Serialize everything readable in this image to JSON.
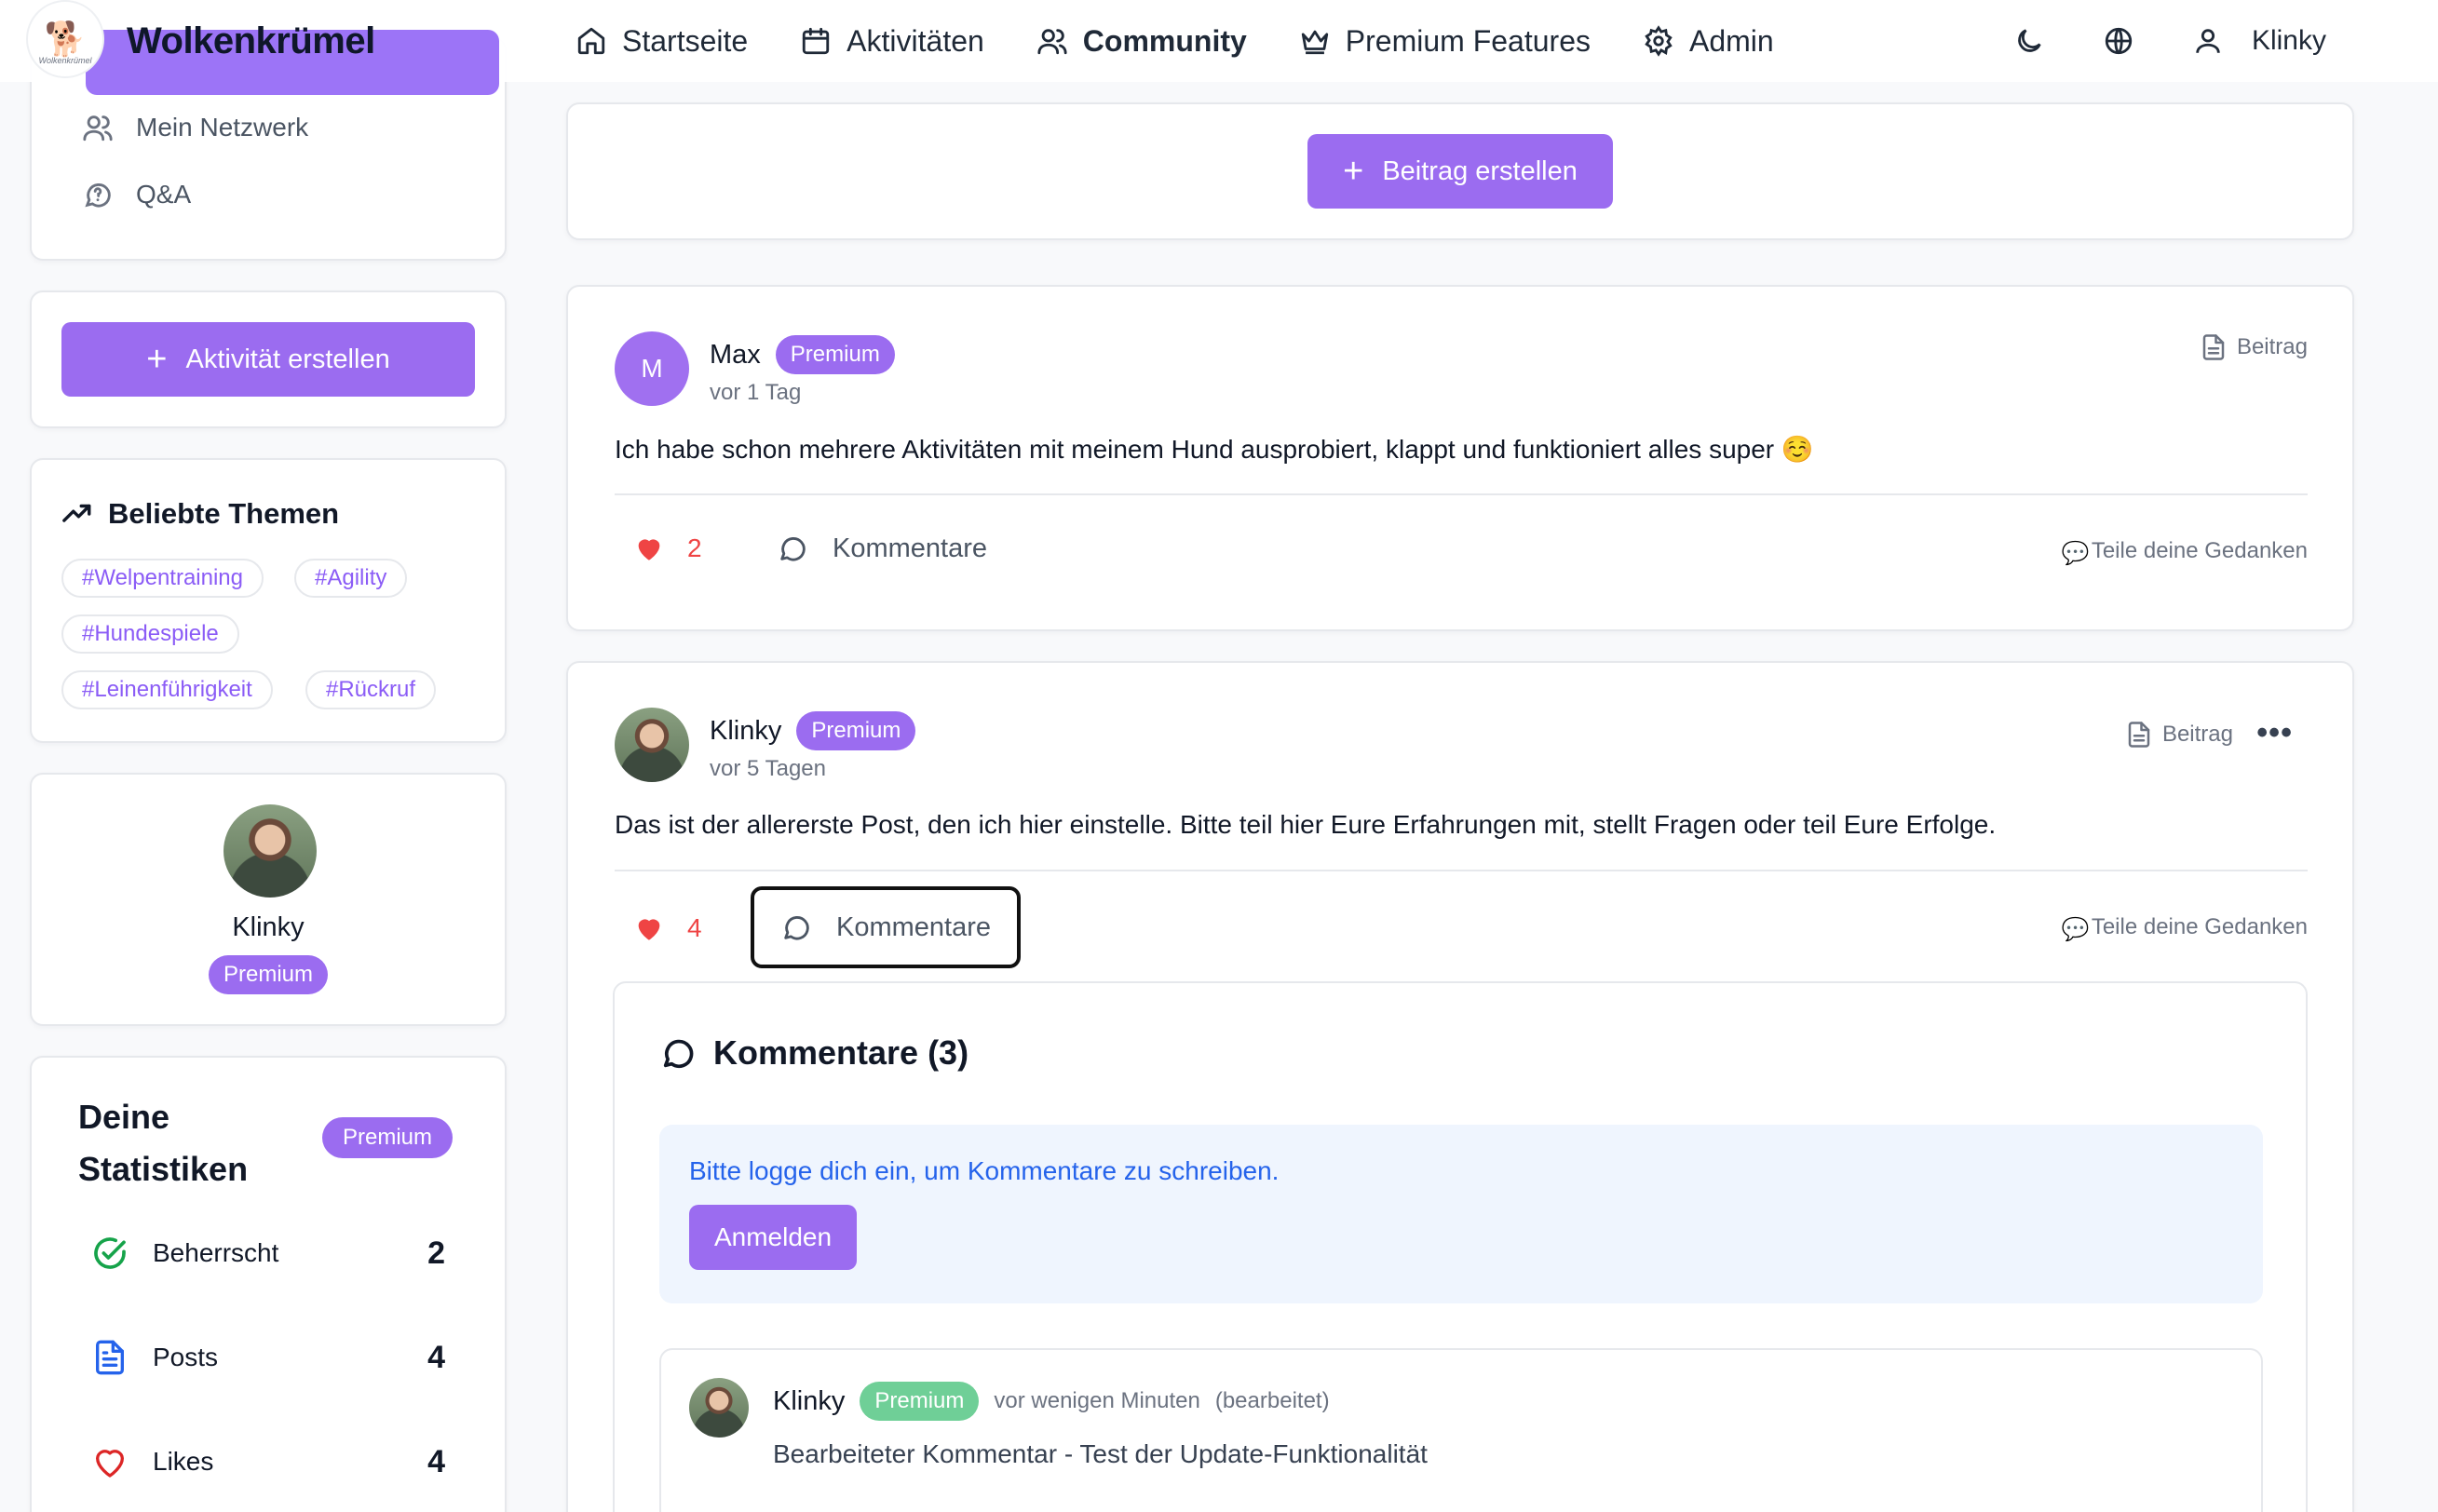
{
  "brand": {
    "name": "Wolkenkrümel",
    "logo_caption": "Wolkenkrümel"
  },
  "nav": {
    "links": [
      {
        "label": "Startseite",
        "icon": "home-icon"
      },
      {
        "label": "Aktivitäten",
        "icon": "calendar-icon"
      },
      {
        "label": "Community",
        "icon": "users-icon",
        "active": true
      },
      {
        "label": "Premium Features",
        "icon": "crown-icon"
      },
      {
        "label": "Admin",
        "icon": "gear-icon"
      }
    ],
    "theme_icon": "moon-icon",
    "language_icon": "globe-icon",
    "user": {
      "name": "Klinky",
      "icon": "user-icon"
    }
  },
  "sidebar": {
    "links": [
      {
        "label": "Mein Netzwerk",
        "icon": "users-icon"
      },
      {
        "label": "Q&A",
        "icon": "question-bubble-icon"
      }
    ],
    "create_activity": "Aktivität erstellen",
    "topics": {
      "title": "Beliebte Themen",
      "tags": [
        "#Welpentraining",
        "#Agility",
        "#Hundespiele",
        "#Leinenführigkeit",
        "#Rückruf"
      ]
    },
    "profile": {
      "name": "Klinky",
      "badge": "Premium"
    },
    "stats": {
      "title_line1": "Deine",
      "title_line2": "Statistiken",
      "badge": "Premium",
      "rows": [
        {
          "label": "Beherrscht",
          "value": "2",
          "icon": "check-circle-icon",
          "color": "#16a34a"
        },
        {
          "label": "Posts",
          "value": "4",
          "icon": "document-icon",
          "color": "#2563eb"
        },
        {
          "label": "Likes",
          "value": "4",
          "icon": "heart-outline-icon",
          "color": "#dc2626"
        }
      ]
    }
  },
  "composer": {
    "create_post": "Beitrag erstellen"
  },
  "posts": [
    {
      "author": "Max",
      "avatar_letter": "M",
      "badge": "Premium",
      "time": "vor 1 Tag",
      "type": "Beitrag",
      "text": "Ich habe schon mehrere Aktivitäten mit meinem Hund ausprobiert, klappt und funktioniert alles super ☺️",
      "likes": "2",
      "comments_label": "Kommentare",
      "share_label": "Teile deine Gedanken"
    },
    {
      "author": "Klinky",
      "badge": "Premium",
      "time": "vor 5 Tagen",
      "type": "Beitrag",
      "text": "Das ist der allererste Post, den ich hier einstelle. Bitte teil hier Eure Erfahrungen mit, stellt Fragen oder teil Eure Erfolge.",
      "likes": "4",
      "comments_label": "Kommentare",
      "share_label": "Teile deine Gedanken",
      "more_label": "•••"
    }
  ],
  "comments": {
    "title": "Kommentare (3)",
    "login_prompt": "Bitte logge dich ein, um Kommentare zu schreiben.",
    "login_button": "Anmelden",
    "items": [
      {
        "author": "Klinky",
        "badge": "Premium",
        "time": "vor wenigen Minuten",
        "edited": "(bearbeitet)",
        "text": "Bearbeiteter Kommentar - Test der Update-Funktionalität"
      }
    ]
  },
  "colors": {
    "accent": "#9b6cf0",
    "like": "#ef4444",
    "link": "#2563eb"
  }
}
